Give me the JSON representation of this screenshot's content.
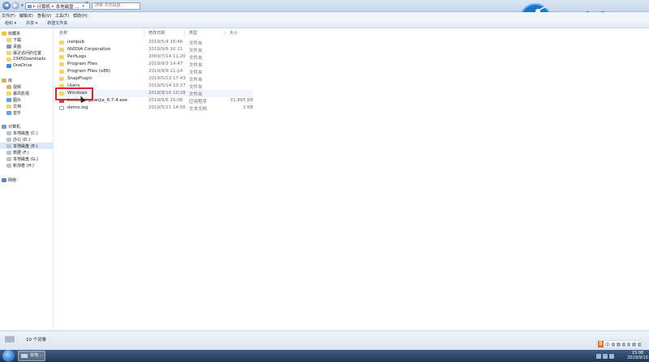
{
  "address_bar": {
    "segments": [
      "计算机",
      "本地磁盘 ..."
    ],
    "search_placeholder": "搜索 本地磁盘 ..."
  },
  "logo": {
    "text": "云骑士",
    "color": "#1d75c8"
  },
  "menu": [
    "文件(F)",
    "编辑(E)",
    "查看(V)",
    "工具(T)",
    "帮助(H)"
  ],
  "toolbar": [
    "组织 ▾",
    "共享 ▾",
    "新建文件夹"
  ],
  "sidebar": {
    "favorites": {
      "title": "收藏夹",
      "items": [
        "下载",
        "桌面",
        "最近访问的位置",
        "2345Downloads"
      ]
    },
    "onedrive": "OneDrive",
    "libraries": {
      "title": "库",
      "items": [
        "视频",
        "暴风影视",
        "图片",
        "文档",
        "音乐"
      ]
    },
    "computer": {
      "title": "计算机",
      "items": [
        "本地磁盘 (C:)",
        "办公 (D:)",
        "本地磁盘 (E:)",
        "数据 (F:)",
        "本地磁盘 (G:)",
        "新加卷 (H:)"
      ],
      "selected_index": 2
    },
    "network": "网络"
  },
  "columns": [
    "名称",
    "修改日期",
    "类型",
    "大小"
  ],
  "files": [
    {
      "name": "inetpub",
      "date": "2019/5/4 16:46",
      "type": "文件夹",
      "size": "",
      "icon": "folder"
    },
    {
      "name": "NVIDIA Corporation",
      "date": "2019/9/6 10:11",
      "type": "文件夹",
      "size": "",
      "icon": "folder"
    },
    {
      "name": "PerfLogs",
      "date": "2009/7/14 11:20",
      "type": "文件夹",
      "size": "",
      "icon": "folder"
    },
    {
      "name": "Program Files",
      "date": "2019/9/3 14:47",
      "type": "文件夹",
      "size": "",
      "icon": "folder"
    },
    {
      "name": "Program Files (x86)",
      "date": "2019/9/9 11:14",
      "type": "文件夹",
      "size": "",
      "icon": "folder"
    },
    {
      "name": "SnapPlugin",
      "date": "2019/5/13 17:43",
      "type": "文件夹",
      "size": "",
      "icon": "folder"
    },
    {
      "name": "Users",
      "date": "2019/5/14 10:27",
      "type": "文件夹",
      "size": "",
      "icon": "folder"
    },
    {
      "name": "Windows",
      "date": "2019/9/10 10:28",
      "type": "文件夹",
      "size": "",
      "icon": "folder"
    },
    {
      "name": "baiduyunguanjia_6.7.4.exe",
      "date": "2019/9/6 15:06",
      "type": "应用程序",
      "size": "31,895 KB",
      "icon": "exe"
    },
    {
      "name": "demo.log",
      "date": "2019/5/21 14:56",
      "type": "文本文档",
      "size": "2 KB",
      "icon": "file"
    }
  ],
  "hover_row_index": 7,
  "status": {
    "count": "10 个对象"
  },
  "taskbar": {
    "task_label": "本地...",
    "ime": {
      "logo": "S",
      "lang": "中"
    },
    "clock_time": "15:08",
    "clock_date": "2019/9/10"
  }
}
